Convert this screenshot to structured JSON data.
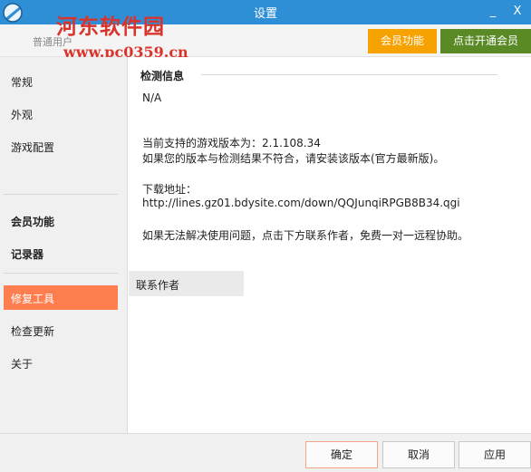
{
  "window": {
    "title": "设置",
    "minimize_glyph": "_",
    "close_glyph": "X"
  },
  "watermark": {
    "text": "河东软件园",
    "url": "www.pc0359.cn"
  },
  "user": {
    "label": "普通用户"
  },
  "vip": {
    "features_label": "会员功能",
    "open_label": "点击开通会员"
  },
  "sidebar": {
    "items": [
      {
        "label": "常规"
      },
      {
        "label": "外观"
      },
      {
        "label": "游戏配置"
      },
      {
        "label": "会员功能"
      },
      {
        "label": "记录器"
      },
      {
        "label": "修复工具"
      },
      {
        "label": "检查更新"
      },
      {
        "label": "关于"
      }
    ]
  },
  "content": {
    "section_title": "检测信息",
    "status": "N/A",
    "supported_version": "当前支持的游戏版本为：2.1.108.34",
    "mismatch_hint": "如果您的版本与检测结果不符合，请安装该版本(官方最新版)。",
    "download_label": "下载地址：",
    "download_url": "http://lines.gz01.bdysite.com/down/QQJunqiRPGB8B34.qgi",
    "help_hint": "如果无法解决使用问题，点击下方联系作者，免费一对一远程协助。",
    "contact_label": "联系作者"
  },
  "footer": {
    "ok_label": "确定",
    "cancel_label": "取消",
    "apply_label": "应用"
  },
  "colors": {
    "titlebar": "#2f8fd6",
    "vip_features": "#f6a200",
    "vip_open": "#5a8a26",
    "sidebar_active": "#ff7e4f",
    "watermark": "#d9342b"
  }
}
